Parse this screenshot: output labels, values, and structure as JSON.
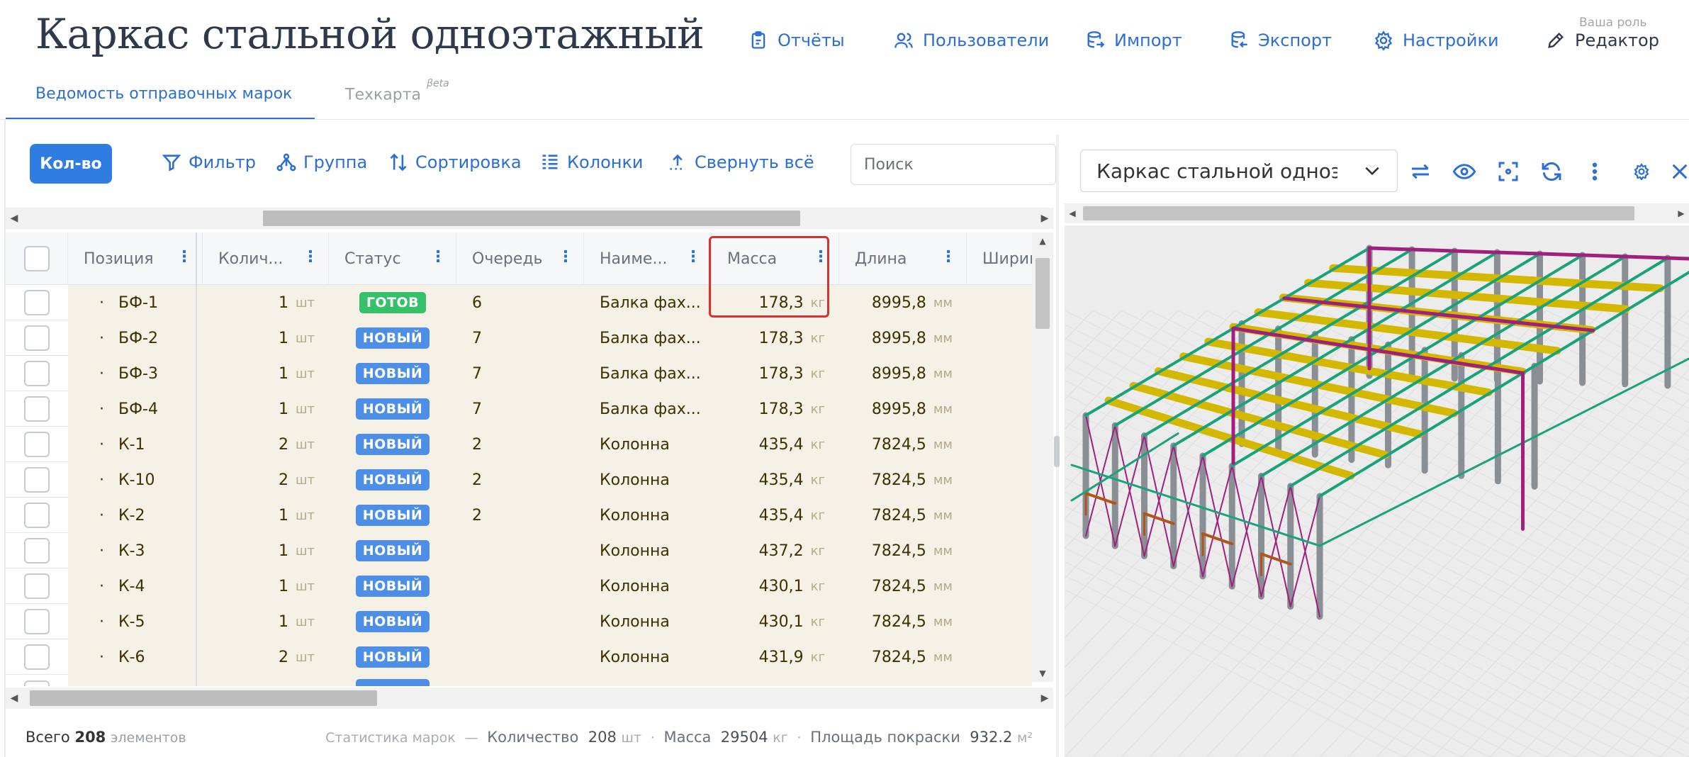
{
  "header": {
    "title": "Каркас стальной одноэтажный",
    "nav": {
      "reports": "Отчёты",
      "users": "Пользователи",
      "import": "Импорт",
      "export": "Экспорт",
      "settings": "Настройки",
      "role_caption": "Ваша роль",
      "role": "Редактор"
    },
    "tabs": {
      "sheet": "Ведомость отправочных марок",
      "techmap": "Техкарта",
      "techmap_badge": "βeta"
    }
  },
  "toolbar": {
    "qty": "Кол-во",
    "filter": "Фильтр",
    "group": "Группа",
    "sort": "Сортировка",
    "columns": "Колонки",
    "collapse": "Свернуть всё",
    "search_placeholder": "Поиск"
  },
  "table": {
    "columns": {
      "position": "Позиция",
      "quantity": "Колич...",
      "status": "Статус",
      "queue": "Очередь",
      "name": "Наиме...",
      "mass": "Масса",
      "length": "Длина",
      "width": "Ширин"
    },
    "units": {
      "qty": "шт",
      "mass": "кг",
      "length": "мм"
    },
    "rows": [
      {
        "pos": "БФ-1",
        "qty": "1",
        "status": "ГОТОВ",
        "queue": "6",
        "name": "Балка фах...",
        "mass": "178,3",
        "length": "8995,8"
      },
      {
        "pos": "БФ-2",
        "qty": "1",
        "status": "НОВЫЙ",
        "queue": "7",
        "name": "Балка фах...",
        "mass": "178,3",
        "length": "8995,8"
      },
      {
        "pos": "БФ-3",
        "qty": "1",
        "status": "НОВЫЙ",
        "queue": "7",
        "name": "Балка фах...",
        "mass": "178,3",
        "length": "8995,8"
      },
      {
        "pos": "БФ-4",
        "qty": "1",
        "status": "НОВЫЙ",
        "queue": "7",
        "name": "Балка фах...",
        "mass": "178,3",
        "length": "8995,8"
      },
      {
        "pos": "К-1",
        "qty": "2",
        "status": "НОВЫЙ",
        "queue": "2",
        "name": "Колонна",
        "mass": "435,4",
        "length": "7824,5"
      },
      {
        "pos": "К-10",
        "qty": "2",
        "status": "НОВЫЙ",
        "queue": "2",
        "name": "Колонна",
        "mass": "435,4",
        "length": "7824,5"
      },
      {
        "pos": "К-2",
        "qty": "1",
        "status": "НОВЫЙ",
        "queue": "2",
        "name": "Колонна",
        "mass": "435,4",
        "length": "7824,5"
      },
      {
        "pos": "К-3",
        "qty": "1",
        "status": "НОВЫЙ",
        "queue": "",
        "name": "Колонна",
        "mass": "437,2",
        "length": "7824,5"
      },
      {
        "pos": "К-4",
        "qty": "1",
        "status": "НОВЫЙ",
        "queue": "",
        "name": "Колонна",
        "mass": "430,1",
        "length": "7824,5"
      },
      {
        "pos": "К-5",
        "qty": "1",
        "status": "НОВЫЙ",
        "queue": "",
        "name": "Колонна",
        "mass": "430,1",
        "length": "7824,5"
      },
      {
        "pos": "К-6",
        "qty": "2",
        "status": "НОВЫЙ",
        "queue": "",
        "name": "Колонна",
        "mass": "431,9",
        "length": "7824,5"
      }
    ]
  },
  "footer": {
    "total_label": "Всего",
    "total": "208",
    "total_unit": "элементов",
    "stats_label": "Статистика марок",
    "qty_label": "Количество",
    "qty_value": "208",
    "qty_unit": "шт",
    "mass_label": "Масса",
    "mass_value": "29504",
    "mass_unit": "кг",
    "area_label": "Площадь покраски",
    "area_value": "932.2",
    "area_unit": "м²"
  },
  "viewer": {
    "model": "Каркас стальной одноэтажный"
  },
  "colors": {
    "accent": "#2b6fd6",
    "badge_new": "#4d8fe6",
    "badge_done": "#37c06a",
    "highlight": "#d8322f",
    "beam_yellow": "#d4b800",
    "brace_teal": "#1aa37a",
    "frame_magenta": "#a0207e",
    "column_gray": "#8a8f96",
    "girt_brown": "#b0561c"
  }
}
